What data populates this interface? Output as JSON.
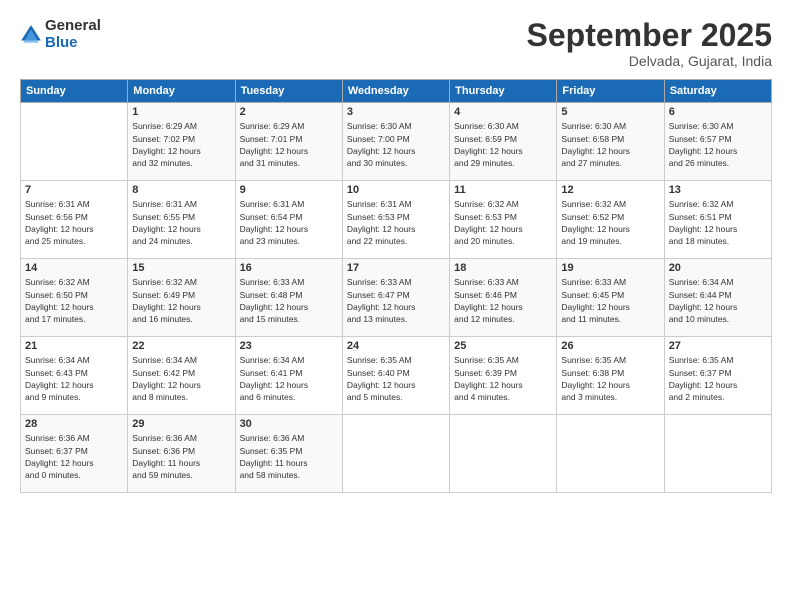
{
  "logo": {
    "general": "General",
    "blue": "Blue"
  },
  "title": "September 2025",
  "location": "Delvada, Gujarat, India",
  "weekdays": [
    "Sunday",
    "Monday",
    "Tuesday",
    "Wednesday",
    "Thursday",
    "Friday",
    "Saturday"
  ],
  "weeks": [
    [
      {
        "day": "",
        "lines": []
      },
      {
        "day": "1",
        "lines": [
          "Sunrise: 6:29 AM",
          "Sunset: 7:02 PM",
          "Daylight: 12 hours",
          "and 32 minutes."
        ]
      },
      {
        "day": "2",
        "lines": [
          "Sunrise: 6:29 AM",
          "Sunset: 7:01 PM",
          "Daylight: 12 hours",
          "and 31 minutes."
        ]
      },
      {
        "day": "3",
        "lines": [
          "Sunrise: 6:30 AM",
          "Sunset: 7:00 PM",
          "Daylight: 12 hours",
          "and 30 minutes."
        ]
      },
      {
        "day": "4",
        "lines": [
          "Sunrise: 6:30 AM",
          "Sunset: 6:59 PM",
          "Daylight: 12 hours",
          "and 29 minutes."
        ]
      },
      {
        "day": "5",
        "lines": [
          "Sunrise: 6:30 AM",
          "Sunset: 6:58 PM",
          "Daylight: 12 hours",
          "and 27 minutes."
        ]
      },
      {
        "day": "6",
        "lines": [
          "Sunrise: 6:30 AM",
          "Sunset: 6:57 PM",
          "Daylight: 12 hours",
          "and 26 minutes."
        ]
      }
    ],
    [
      {
        "day": "7",
        "lines": [
          "Sunrise: 6:31 AM",
          "Sunset: 6:56 PM",
          "Daylight: 12 hours",
          "and 25 minutes."
        ]
      },
      {
        "day": "8",
        "lines": [
          "Sunrise: 6:31 AM",
          "Sunset: 6:55 PM",
          "Daylight: 12 hours",
          "and 24 minutes."
        ]
      },
      {
        "day": "9",
        "lines": [
          "Sunrise: 6:31 AM",
          "Sunset: 6:54 PM",
          "Daylight: 12 hours",
          "and 23 minutes."
        ]
      },
      {
        "day": "10",
        "lines": [
          "Sunrise: 6:31 AM",
          "Sunset: 6:53 PM",
          "Daylight: 12 hours",
          "and 22 minutes."
        ]
      },
      {
        "day": "11",
        "lines": [
          "Sunrise: 6:32 AM",
          "Sunset: 6:53 PM",
          "Daylight: 12 hours",
          "and 20 minutes."
        ]
      },
      {
        "day": "12",
        "lines": [
          "Sunrise: 6:32 AM",
          "Sunset: 6:52 PM",
          "Daylight: 12 hours",
          "and 19 minutes."
        ]
      },
      {
        "day": "13",
        "lines": [
          "Sunrise: 6:32 AM",
          "Sunset: 6:51 PM",
          "Daylight: 12 hours",
          "and 18 minutes."
        ]
      }
    ],
    [
      {
        "day": "14",
        "lines": [
          "Sunrise: 6:32 AM",
          "Sunset: 6:50 PM",
          "Daylight: 12 hours",
          "and 17 minutes."
        ]
      },
      {
        "day": "15",
        "lines": [
          "Sunrise: 6:32 AM",
          "Sunset: 6:49 PM",
          "Daylight: 12 hours",
          "and 16 minutes."
        ]
      },
      {
        "day": "16",
        "lines": [
          "Sunrise: 6:33 AM",
          "Sunset: 6:48 PM",
          "Daylight: 12 hours",
          "and 15 minutes."
        ]
      },
      {
        "day": "17",
        "lines": [
          "Sunrise: 6:33 AM",
          "Sunset: 6:47 PM",
          "Daylight: 12 hours",
          "and 13 minutes."
        ]
      },
      {
        "day": "18",
        "lines": [
          "Sunrise: 6:33 AM",
          "Sunset: 6:46 PM",
          "Daylight: 12 hours",
          "and 12 minutes."
        ]
      },
      {
        "day": "19",
        "lines": [
          "Sunrise: 6:33 AM",
          "Sunset: 6:45 PM",
          "Daylight: 12 hours",
          "and 11 minutes."
        ]
      },
      {
        "day": "20",
        "lines": [
          "Sunrise: 6:34 AM",
          "Sunset: 6:44 PM",
          "Daylight: 12 hours",
          "and 10 minutes."
        ]
      }
    ],
    [
      {
        "day": "21",
        "lines": [
          "Sunrise: 6:34 AM",
          "Sunset: 6:43 PM",
          "Daylight: 12 hours",
          "and 9 minutes."
        ]
      },
      {
        "day": "22",
        "lines": [
          "Sunrise: 6:34 AM",
          "Sunset: 6:42 PM",
          "Daylight: 12 hours",
          "and 8 minutes."
        ]
      },
      {
        "day": "23",
        "lines": [
          "Sunrise: 6:34 AM",
          "Sunset: 6:41 PM",
          "Daylight: 12 hours",
          "and 6 minutes."
        ]
      },
      {
        "day": "24",
        "lines": [
          "Sunrise: 6:35 AM",
          "Sunset: 6:40 PM",
          "Daylight: 12 hours",
          "and 5 minutes."
        ]
      },
      {
        "day": "25",
        "lines": [
          "Sunrise: 6:35 AM",
          "Sunset: 6:39 PM",
          "Daylight: 12 hours",
          "and 4 minutes."
        ]
      },
      {
        "day": "26",
        "lines": [
          "Sunrise: 6:35 AM",
          "Sunset: 6:38 PM",
          "Daylight: 12 hours",
          "and 3 minutes."
        ]
      },
      {
        "day": "27",
        "lines": [
          "Sunrise: 6:35 AM",
          "Sunset: 6:37 PM",
          "Daylight: 12 hours",
          "and 2 minutes."
        ]
      }
    ],
    [
      {
        "day": "28",
        "lines": [
          "Sunrise: 6:36 AM",
          "Sunset: 6:37 PM",
          "Daylight: 12 hours",
          "and 0 minutes."
        ]
      },
      {
        "day": "29",
        "lines": [
          "Sunrise: 6:36 AM",
          "Sunset: 6:36 PM",
          "Daylight: 11 hours",
          "and 59 minutes."
        ]
      },
      {
        "day": "30",
        "lines": [
          "Sunrise: 6:36 AM",
          "Sunset: 6:35 PM",
          "Daylight: 11 hours",
          "and 58 minutes."
        ]
      },
      {
        "day": "",
        "lines": []
      },
      {
        "day": "",
        "lines": []
      },
      {
        "day": "",
        "lines": []
      },
      {
        "day": "",
        "lines": []
      }
    ]
  ]
}
